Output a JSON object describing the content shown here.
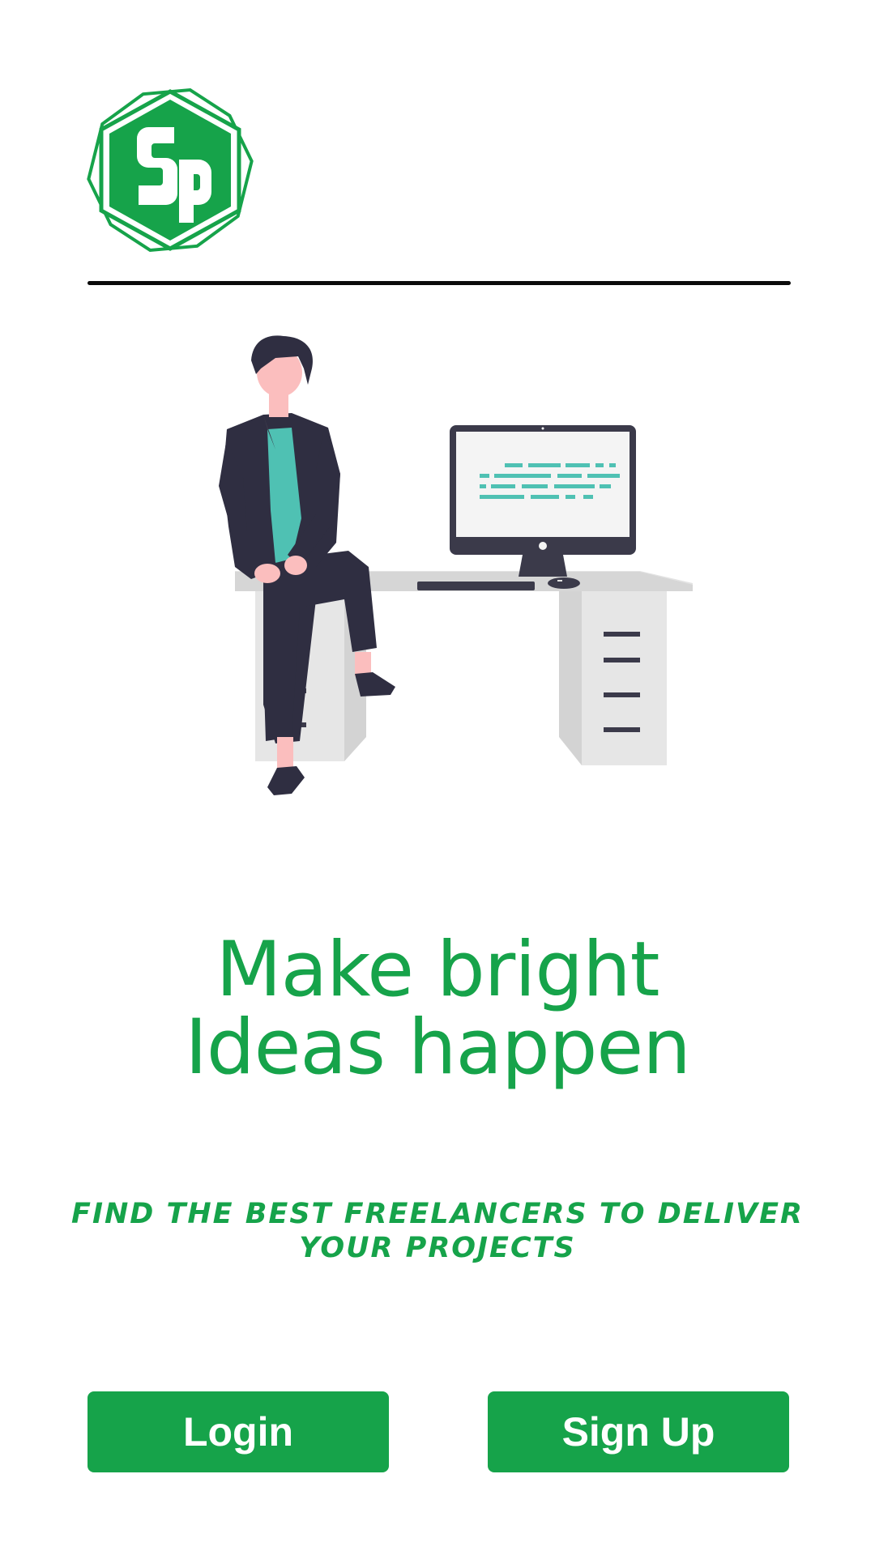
{
  "brand": {
    "logo_text": "Sp",
    "accent_color": "#16a34a",
    "logo_icon": "sp-logo-icon"
  },
  "hero": {
    "illustration": "person-at-desk-illustration"
  },
  "headline": {
    "line1": "Make bright",
    "line2": "Ideas happen"
  },
  "tagline": "FIND THE BEST FREELANCERS TO DELIVER YOUR PROJECTS",
  "actions": {
    "login_label": "Login",
    "signup_label": "Sign Up"
  }
}
